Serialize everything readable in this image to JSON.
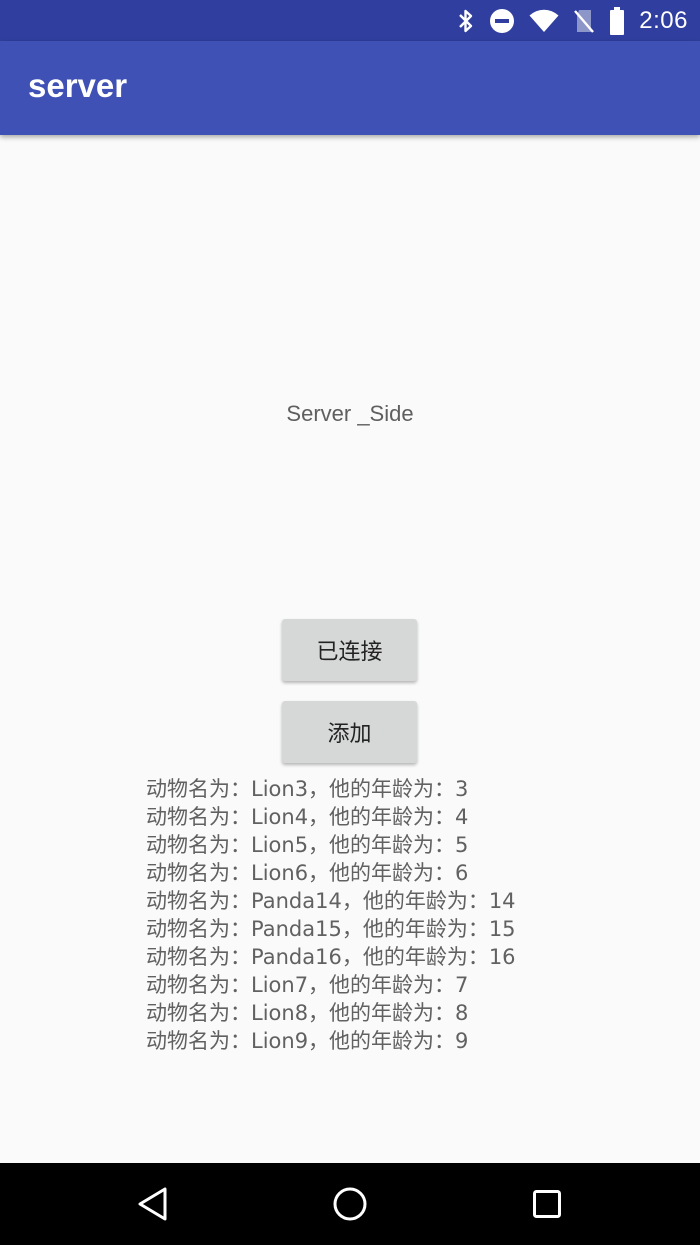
{
  "status_bar": {
    "time": "2:06",
    "icons": [
      "bluetooth-icon",
      "do-not-disturb-icon",
      "wifi-icon",
      "no-sim-icon",
      "battery-icon"
    ]
  },
  "app_bar": {
    "title": "server"
  },
  "main": {
    "center_label": "Server _Side",
    "connected_button_label": "已连接",
    "add_button_label": "添加",
    "records": [
      "动物名为：Lion3，他的年龄为：3",
      "动物名为：Lion4，他的年龄为：4",
      "动物名为：Lion5，他的年龄为：5",
      "动物名为：Lion6，他的年龄为：6",
      "动物名为：Panda14，他的年龄为：14",
      "动物名为：Panda15，他的年龄为：15",
      "动物名为：Panda16，他的年龄为：16",
      "动物名为：Lion7，他的年龄为：7",
      "动物名为：Lion8，他的年龄为：8",
      "动物名为：Lion9，他的年龄为：9"
    ]
  },
  "nav_bar": {
    "icons": [
      "back-icon",
      "home-icon",
      "recents-icon"
    ]
  },
  "colors": {
    "status_bar": "#303f9f",
    "app_bar": "#3f51b5",
    "background": "#fafafa",
    "button": "#d6d7d7",
    "nav_bar": "#000000"
  }
}
